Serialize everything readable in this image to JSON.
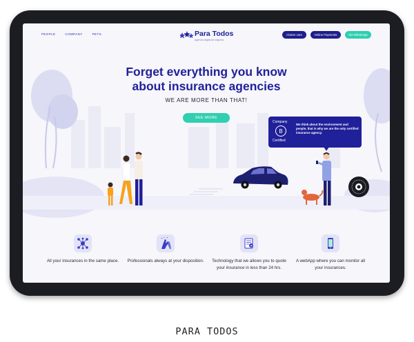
{
  "nav": {
    "links": [
      "PEOPLE",
      "COMPANY",
      "PETS"
    ],
    "logo_name": "Para Todos",
    "logo_tagline": "Agencia digital de seguros",
    "buttons": {
      "claims": "Claims care",
      "payments": "Online Payments",
      "whatsapp": "WA WhatsApp"
    }
  },
  "hero": {
    "title_line1": "Forget everything you know",
    "title_line2": "about insurance agencies",
    "subtitle": "WE ARE MORE THAN THAT!",
    "cta": "SEE MORE"
  },
  "bubble": {
    "company": "Company",
    "badge": "B",
    "certified": "Certified",
    "text": "We think about the environment and people, that is why we are the only certified insurance agency."
  },
  "features": [
    {
      "icon": "network-icon",
      "text": "All your insurances in the same place."
    },
    {
      "icon": "high-five-icon",
      "text": "Professionals always at your disposition."
    },
    {
      "icon": "document-icon",
      "text": "Technology that we allows you to quote your insurance in less than 24 hrs."
    },
    {
      "icon": "mobile-icon",
      "text": "A webApp where you can monitor all your insurances."
    }
  ],
  "caption": "PARA TODOS",
  "colors": {
    "primary": "#20209a",
    "accent": "#2fcfb0",
    "frame": "#1c1d22",
    "background": "#f6f6fb"
  }
}
